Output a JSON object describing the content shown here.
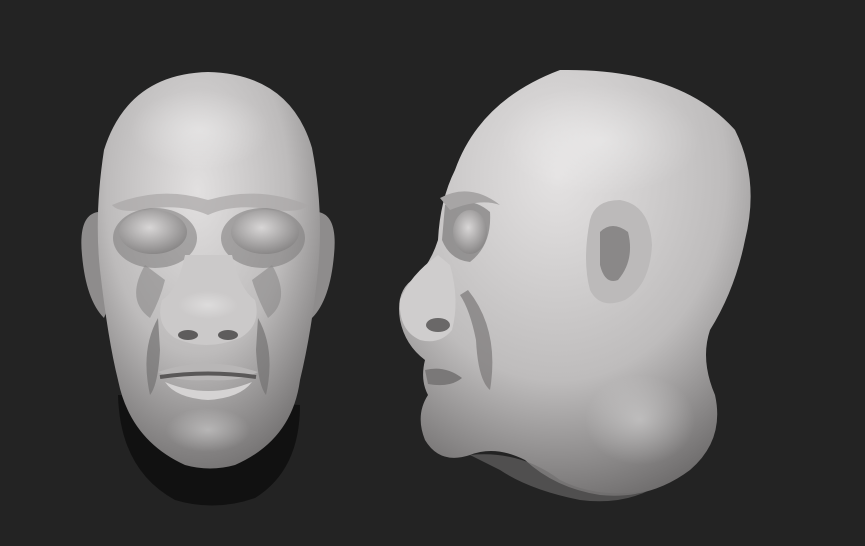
{
  "scene": {
    "background_color": "#232323",
    "material_color": "#c9c7c7",
    "models": [
      {
        "view": "front"
      },
      {
        "view": "side-profile"
      }
    ]
  }
}
